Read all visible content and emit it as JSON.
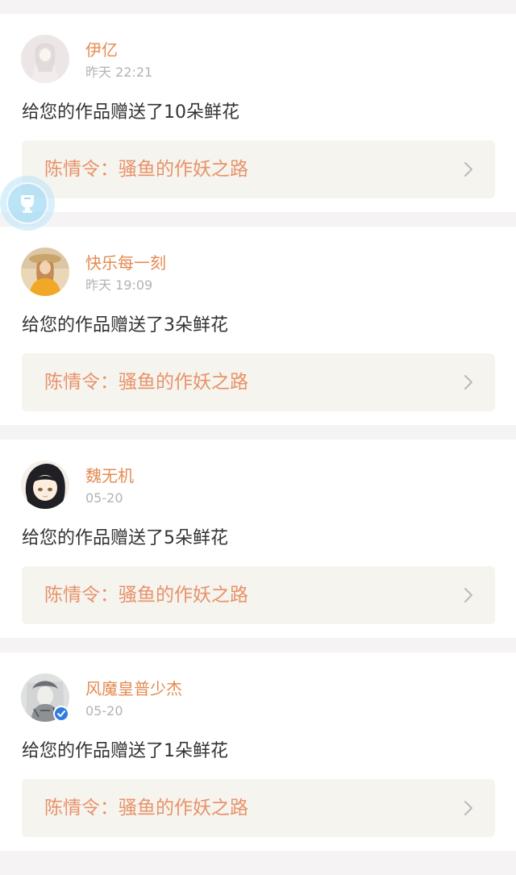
{
  "notifications": [
    {
      "username": "伊亿",
      "time": "昨天 22:21",
      "message": "给您的作品赠送了10朵鲜花",
      "work_title": "陈情令：骚鱼的作妖之路",
      "avatar_icon": "avatar-white-robed-figure",
      "verified": false
    },
    {
      "username": "快乐每一刻",
      "time": "昨天 19:09",
      "message": "给您的作品赠送了3朵鲜花",
      "work_title": "陈情令：骚鱼的作妖之路",
      "avatar_icon": "avatar-girl-in-yellow",
      "verified": false
    },
    {
      "username": "魏无机",
      "time": "05-20",
      "message": "给您的作品赠送了5朵鲜花",
      "work_title": "陈情令：骚鱼的作妖之路",
      "avatar_icon": "avatar-anime-dark-hair",
      "verified": false
    },
    {
      "username": "风魔皇普少杰",
      "time": "05-20",
      "message": "给您的作品赠送了1朵鲜花",
      "work_title": "陈情令：骚鱼的作妖之路",
      "avatar_icon": "avatar-sketch-illustration",
      "verified": true
    }
  ],
  "floating_badge_icon": "trophy-cup-icon",
  "colors": {
    "username": "#e58a52",
    "work_title": "#e8926a",
    "time": "#b3b3b3",
    "message": "#333333",
    "background": "#f5f3f3",
    "link_box": "#f5f4ee",
    "verified_badge": "#2f7de1"
  }
}
